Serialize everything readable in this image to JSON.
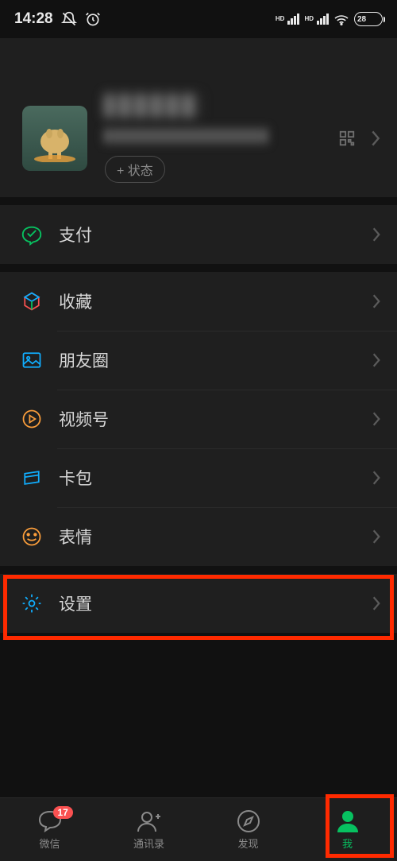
{
  "status": {
    "time": "14:28",
    "battery": "28"
  },
  "profile": {
    "status_button": "+ 状态"
  },
  "menu": {
    "pay": "支付",
    "favorites": "收藏",
    "moments": "朋友圈",
    "channels": "视频号",
    "cards": "卡包",
    "stickers": "表情",
    "settings": "设置"
  },
  "tabs": {
    "chats": "微信",
    "chats_badge": "17",
    "contacts": "通讯录",
    "discover": "发现",
    "me": "我"
  }
}
